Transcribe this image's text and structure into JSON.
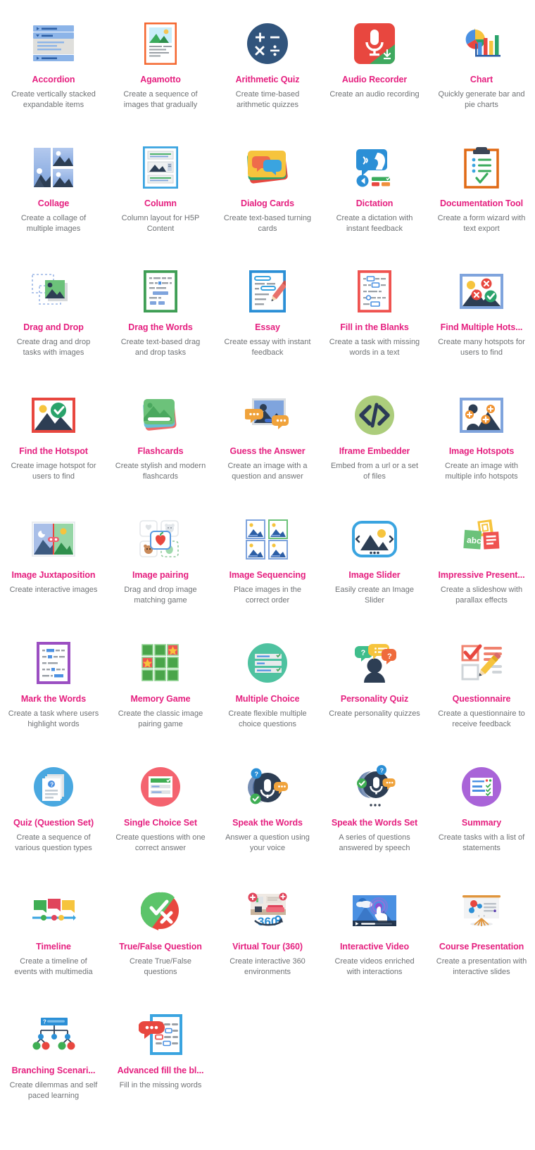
{
  "page": {
    "title_color": "#e51f7f",
    "description_color": "#6f7275",
    "background": "#ffffff",
    "columns": 5
  },
  "content_types": [
    {
      "title": "Accordion",
      "desc": "Create vertically stacked expandable items",
      "icon": "accordion-icon"
    },
    {
      "title": "Agamotto",
      "desc": "Create a sequence of images that gradually",
      "icon": "agamotto-icon"
    },
    {
      "title": "Arithmetic Quiz",
      "desc": "Create time-based arithmetic quizzes",
      "icon": "arithmetic-quiz-icon"
    },
    {
      "title": "Audio Recorder",
      "desc": "Create an audio recording",
      "icon": "audio-recorder-icon"
    },
    {
      "title": "Chart",
      "desc": "Quickly generate bar and pie charts",
      "icon": "chart-icon"
    },
    {
      "title": "Collage",
      "desc": "Create a collage of multiple images",
      "icon": "collage-icon"
    },
    {
      "title": "Column",
      "desc": "Column layout for H5P Content",
      "icon": "column-icon"
    },
    {
      "title": "Dialog Cards",
      "desc": "Create text-based turning cards",
      "icon": "dialog-cards-icon"
    },
    {
      "title": "Dictation",
      "desc": "Create a dictation with instant feedback",
      "icon": "dictation-icon"
    },
    {
      "title": "Documentation Tool",
      "desc": "Create a form wizard with text export",
      "icon": "documentation-tool-icon"
    },
    {
      "title": "Drag and Drop",
      "desc": "Create drag and drop tasks with images",
      "icon": "drag-and-drop-icon"
    },
    {
      "title": "Drag the Words",
      "desc": "Create text-based drag and drop tasks",
      "icon": "drag-the-words-icon"
    },
    {
      "title": "Essay",
      "desc": "Create essay with instant feedback",
      "icon": "essay-icon"
    },
    {
      "title": "Fill in the Blanks",
      "desc": "Create a task with missing words in a text",
      "icon": "fill-in-the-blanks-icon"
    },
    {
      "title": "Find Multiple Hots...",
      "desc": "Create many hotspots for users to find",
      "icon": "find-multiple-hotspots-icon"
    },
    {
      "title": "Find the Hotspot",
      "desc": "Create image hotspot for users to find",
      "icon": "find-the-hotspot-icon"
    },
    {
      "title": "Flashcards",
      "desc": "Create stylish and modern flashcards",
      "icon": "flashcards-icon"
    },
    {
      "title": "Guess the Answer",
      "desc": "Create an image with a question and answer",
      "icon": "guess-the-answer-icon"
    },
    {
      "title": "Iframe Embedder",
      "desc": "Embed from a url or a set of files",
      "icon": "iframe-embedder-icon"
    },
    {
      "title": "Image Hotspots",
      "desc": "Create an image with multiple info hotspots",
      "icon": "image-hotspots-icon"
    },
    {
      "title": "Image Juxtaposition",
      "desc": "Create interactive images",
      "icon": "image-juxtaposition-icon"
    },
    {
      "title": "Image pairing",
      "desc": "Drag and drop image matching game",
      "icon": "image-pairing-icon"
    },
    {
      "title": "Image Sequencing",
      "desc": "Place images in the correct order",
      "icon": "image-sequencing-icon"
    },
    {
      "title": "Image Slider",
      "desc": "Easily create an Image Slider",
      "icon": "image-slider-icon"
    },
    {
      "title": "Impressive Present...",
      "desc": "Create a slideshow with parallax effects",
      "icon": "impressive-presentation-icon"
    },
    {
      "title": "Mark the Words",
      "desc": "Create a task where users highlight words",
      "icon": "mark-the-words-icon"
    },
    {
      "title": "Memory Game",
      "desc": "Create the classic image pairing game",
      "icon": "memory-game-icon"
    },
    {
      "title": "Multiple Choice",
      "desc": "Create flexible multiple choice questions",
      "icon": "multiple-choice-icon"
    },
    {
      "title": "Personality Quiz",
      "desc": "Create personality quizzes",
      "icon": "personality-quiz-icon"
    },
    {
      "title": "Questionnaire",
      "desc": "Create a questionnaire to receive feedback",
      "icon": "questionnaire-icon"
    },
    {
      "title": "Quiz (Question Set)",
      "desc": "Create a sequence of various question types",
      "icon": "quiz-question-set-icon"
    },
    {
      "title": "Single Choice Set",
      "desc": "Create questions with one correct answer",
      "icon": "single-choice-set-icon"
    },
    {
      "title": "Speak the Words",
      "desc": "Answer a question using your voice",
      "icon": "speak-the-words-icon"
    },
    {
      "title": "Speak the Words Set",
      "desc": "A series of questions answered by speech",
      "icon": "speak-the-words-set-icon"
    },
    {
      "title": "Summary",
      "desc": "Create tasks with a list of statements",
      "icon": "summary-icon"
    },
    {
      "title": "Timeline",
      "desc": "Create a timeline of events with multimedia",
      "icon": "timeline-icon"
    },
    {
      "title": "True/False Question",
      "desc": "Create True/False questions",
      "icon": "true-false-question-icon"
    },
    {
      "title": "Virtual Tour (360)",
      "desc": "Create interactive 360 environments",
      "icon": "virtual-tour-360-icon"
    },
    {
      "title": "Interactive Video",
      "desc": "Create videos enriched with interactions",
      "icon": "interactive-video-icon"
    },
    {
      "title": "Course Presentation",
      "desc": "Create a presentation with interactive slides",
      "icon": "course-presentation-icon"
    },
    {
      "title": "Branching Scenari...",
      "desc": "Create dilemmas and self paced learning",
      "icon": "branching-scenario-icon"
    },
    {
      "title": "Advanced fill the bl...",
      "desc": "Fill in the missing words",
      "icon": "advanced-fill-the-blanks-icon"
    }
  ]
}
